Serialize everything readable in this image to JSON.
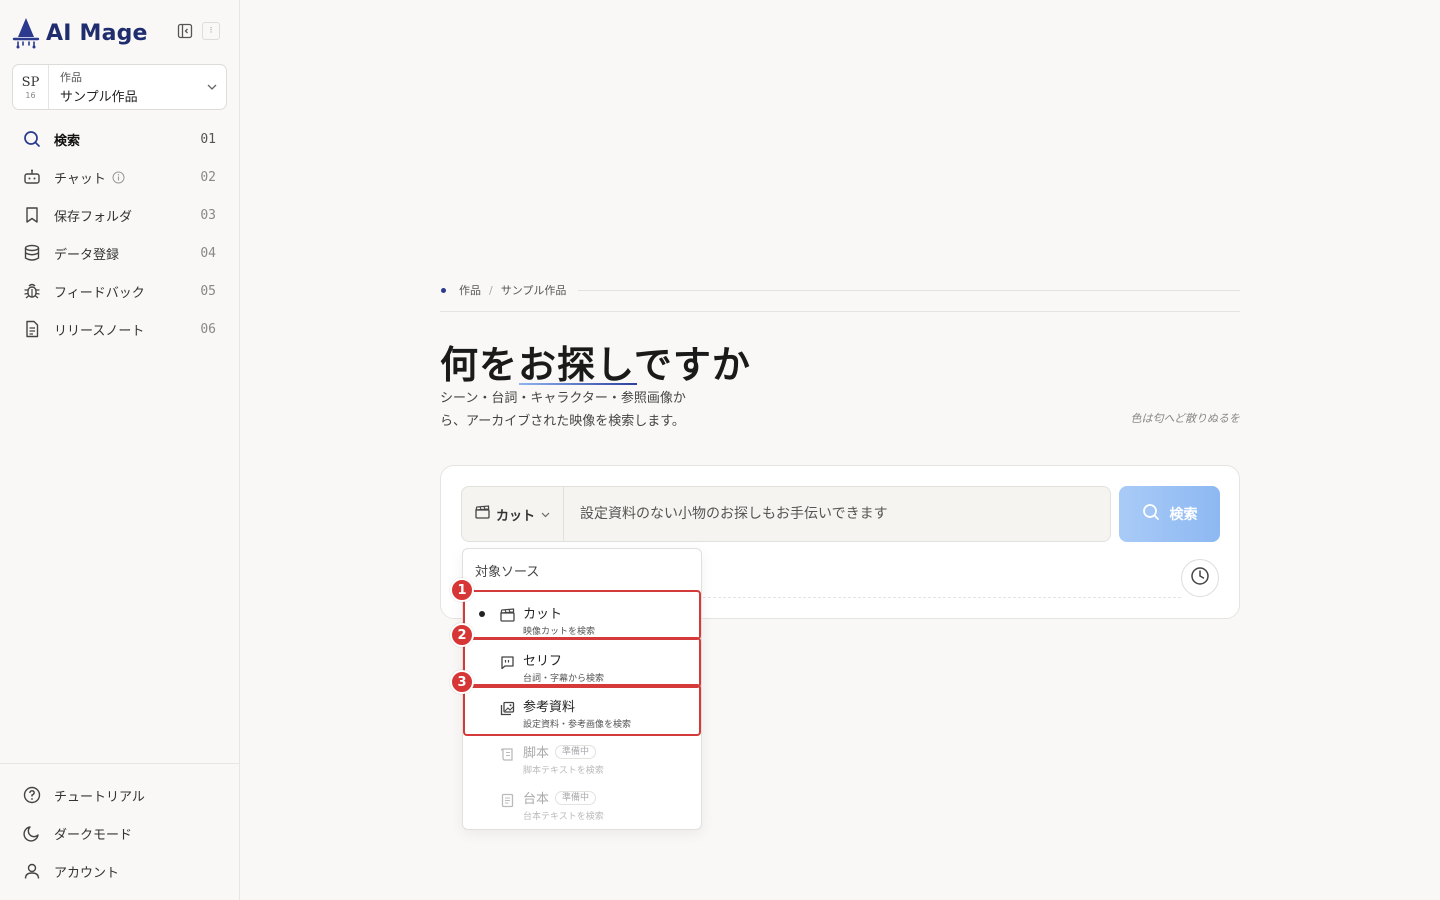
{
  "brand": {
    "name": "AI Mage",
    "panel_toggle_icon": "sidebar-collapse-icon",
    "extra_icon": "misc-icon"
  },
  "project": {
    "abbr": "SP",
    "num": "16",
    "label": "作品",
    "name": "サンプル作品"
  },
  "nav": {
    "items": [
      {
        "label": "検索",
        "num": "01",
        "icon": "search-icon"
      },
      {
        "label": "チャット",
        "num": "02",
        "icon": "robot-icon"
      },
      {
        "label": "保存フォルダ",
        "num": "03",
        "icon": "bookmark-icon"
      },
      {
        "label": "データ登録",
        "num": "04",
        "icon": "database-icon"
      },
      {
        "label": "フィードバック",
        "num": "05",
        "icon": "bug-icon"
      },
      {
        "label": "リリースノート",
        "num": "06",
        "icon": "document-icon"
      }
    ],
    "bottom": [
      {
        "label": "チュートリアル",
        "icon": "help-circle-icon"
      },
      {
        "label": "ダークモード",
        "icon": "moon-icon"
      },
      {
        "label": "アカウント",
        "icon": "user-icon"
      }
    ]
  },
  "breadcrumb": {
    "a": "作品",
    "sep": "/",
    "b": "サンプル作品"
  },
  "hero": {
    "title": "何をお探しですか",
    "subtitle": "シーン・台詞・キャラクター・参照画像から、アーカイブされた映像を検索します。",
    "poem": "色は匂へど散りぬるを"
  },
  "search": {
    "source_label": "カット",
    "placeholder": "設定資料のない小物のお探しもお手伝いできます",
    "button_label": "検索"
  },
  "dropdown": {
    "heading": "対象ソース",
    "items": [
      {
        "title": "カット",
        "desc": "映像カットを検索",
        "selected": true
      },
      {
        "title": "セリフ",
        "desc": "台詞・字幕から検索"
      },
      {
        "title": "参考資料",
        "desc": "設定資料・参考画像を検索"
      },
      {
        "title": "脚本",
        "desc": "脚本テキストを検索",
        "badge": "準備中"
      },
      {
        "title": "台本",
        "desc": "台本テキストを検索",
        "badge": "準備中"
      }
    ]
  },
  "annotations": [
    "1",
    "2",
    "3"
  ],
  "colors": {
    "brand": "#1f2d6e",
    "accent": "#2b3a8f",
    "search_button": "#a9cbf7",
    "annotation": "#d43a3a"
  }
}
